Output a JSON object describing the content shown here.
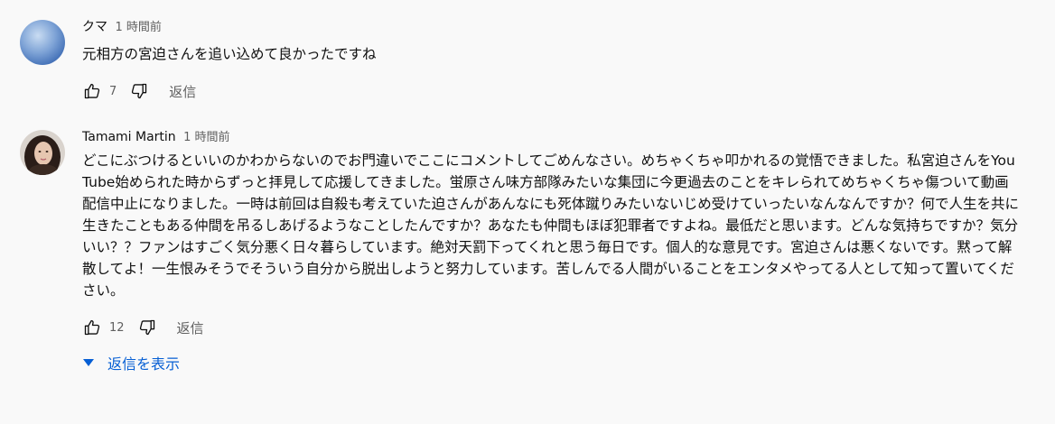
{
  "comments": [
    {
      "author": "クマ",
      "time": "1 時間前",
      "text": "元相方の宮迫さんを追い込めて良かったですね",
      "likes": "7",
      "reply_label": "返信",
      "avatar_colors": [
        "#3f6db5",
        "#a7c4e8"
      ]
    },
    {
      "author": "Tamami Martin",
      "time": "1 時間前",
      "text": "どこにぶつけるといいのかわからないのでお門違いでここにコメントしてごめんなさい。めちゃくちゃ叩かれるの覚悟できました。私宮迫さんをYouTube始められた時からずっと拝見して応援してきました。蛍原さん味方部隊みたいな集団に今更過去のことをキレられてめちゃくちゃ傷ついて動画配信中止になりました。一時は前回は自殺も考えていた迫さんがあんなにも死体蹴りみたいないじめ受けていったいなんなんですか？何で人生を共に生きたこともある仲間を吊るしあげるようなことしたんですか？あなたも仲間もほぼ犯罪者ですよね。最低だと思います。どんな気持ちですか？気分いい？？ファンはすごく気分悪く日々暮らしています。絶対天罰下ってくれと思う毎日です。個人的な意見です。宮迫さんは悪くないです。黙って解散してよ！一生恨みそうでそういう自分から脱出しようと努力しています。苦しんでる人間がいることをエンタメやってる人として知って置いてください。",
      "likes": "12",
      "reply_label": "返信",
      "show_replies_label": "返信を表示",
      "avatar_colors": [
        "#d8d2cc",
        "#2a1d18"
      ]
    }
  ],
  "colors": {
    "link": "#065fd4",
    "secondary_text": "#606060",
    "background": "#f9f9f9"
  }
}
